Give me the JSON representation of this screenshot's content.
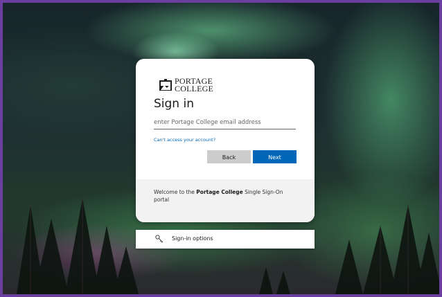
{
  "logo": {
    "line1": "PORTAGE",
    "line2": "COLLEGE"
  },
  "signin": {
    "title": "Sign in",
    "email_placeholder": "enter Portage College email address",
    "email_value": "",
    "cant_access_link": "Can't access your account?",
    "back_label": "Back",
    "next_label": "Next"
  },
  "footer": {
    "prefix": "Welcome to the ",
    "bold": "Portage College",
    "suffix": " Single Sign-On portal"
  },
  "options": {
    "label": "Sign-in options",
    "icon": "key-icon"
  },
  "colors": {
    "accent": "#0067b8",
    "back_button": "#cccccc",
    "footer_bg": "#f2f2f2",
    "frame_border": "#6b3fa0"
  }
}
